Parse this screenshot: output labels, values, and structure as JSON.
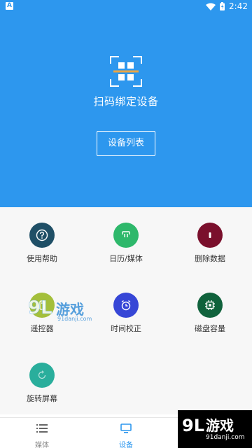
{
  "status_bar": {
    "left_badge": "A",
    "time": "2:42",
    "icons": [
      "wifi-icon",
      "battery-icon"
    ]
  },
  "hero": {
    "title": "扫码绑定设备",
    "button_label": "设备列表",
    "icon": "qr-scan-icon",
    "background_color": "#2d97ee"
  },
  "grid": {
    "items": [
      {
        "label": "使用帮助",
        "icon": "question-icon",
        "color": "#1f4f66"
      },
      {
        "label": "日历/媒体",
        "icon": "calendar-media-icon",
        "color": "#2eb86b"
      },
      {
        "label": "删除数据",
        "icon": "delete-data-icon",
        "color": "#7a0f2c"
      },
      {
        "label": "遥控器",
        "icon": "remote-control-icon",
        "color": "#a4bf3b"
      },
      {
        "label": "时间校正",
        "icon": "alarm-clock-icon",
        "color": "#3646d6"
      },
      {
        "label": "磁盘容量",
        "icon": "chip-icon",
        "color": "#10623c"
      },
      {
        "label": "旋转屏幕",
        "icon": "rotate-icon",
        "color": "#2aae9c"
      }
    ]
  },
  "watermark": {
    "brand": "游戏",
    "site": "91danji.com",
    "logo_mark": "9L"
  },
  "bottom_nav": {
    "items": [
      {
        "label": "媒体",
        "icon": "list-icon",
        "active": false
      },
      {
        "label": "设备",
        "icon": "monitor-icon",
        "active": true
      },
      {
        "label": "",
        "icon": "",
        "active": false
      }
    ],
    "active_color": "#2d97ee",
    "inactive_color": "#888888"
  }
}
